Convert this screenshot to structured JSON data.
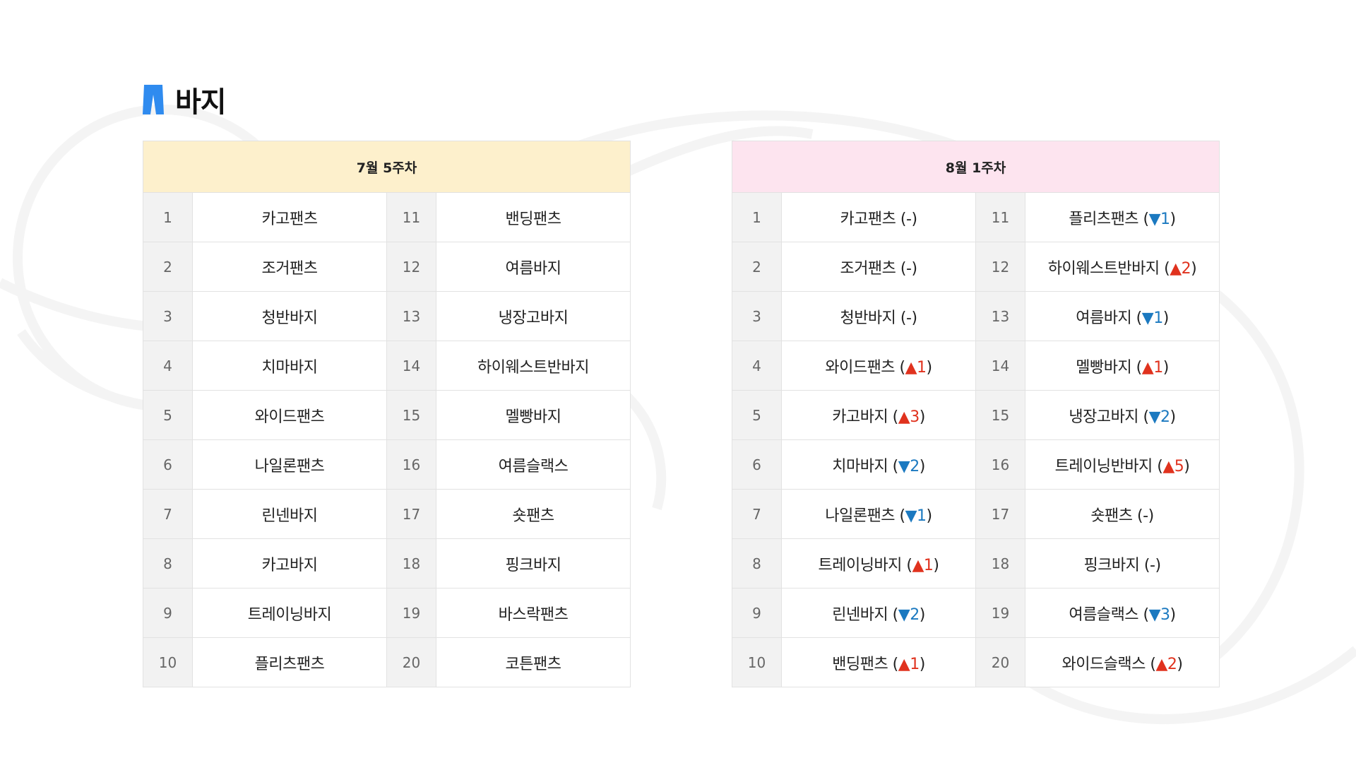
{
  "category": {
    "title": "바지",
    "icon": "pants-icon",
    "icon_color": "#2f8bef"
  },
  "colors": {
    "left_header_bg": "#fdf0cc",
    "right_header_bg": "#fde4ef",
    "up_color": "#e0321e",
    "down_color": "#1b79c0"
  },
  "left_table": {
    "header": "7월 5주차",
    "rows": [
      {
        "rank_a": "1",
        "name_a": "카고팬츠",
        "rank_b": "11",
        "name_b": "밴딩팬츠"
      },
      {
        "rank_a": "2",
        "name_a": "조거팬츠",
        "rank_b": "12",
        "name_b": "여름바지"
      },
      {
        "rank_a": "3",
        "name_a": "청반바지",
        "rank_b": "13",
        "name_b": "냉장고바지"
      },
      {
        "rank_a": "4",
        "name_a": "치마바지",
        "rank_b": "14",
        "name_b": "하이웨스트반바지"
      },
      {
        "rank_a": "5",
        "name_a": "와이드팬츠",
        "rank_b": "15",
        "name_b": "멜빵바지"
      },
      {
        "rank_a": "6",
        "name_a": "나일론팬츠",
        "rank_b": "16",
        "name_b": "여름슬랙스"
      },
      {
        "rank_a": "7",
        "name_a": "린넨바지",
        "rank_b": "17",
        "name_b": "숏팬츠"
      },
      {
        "rank_a": "8",
        "name_a": "카고바지",
        "rank_b": "18",
        "name_b": "핑크바지"
      },
      {
        "rank_a": "9",
        "name_a": "트레이닝바지",
        "rank_b": "19",
        "name_b": "바스락팬츠"
      },
      {
        "rank_a": "10",
        "name_a": "플리츠팬츠",
        "rank_b": "20",
        "name_b": "코튼팬츠"
      }
    ]
  },
  "right_table": {
    "header": "8월 1주차",
    "rows": [
      {
        "rank_a": "1",
        "name_a": "카고팬츠",
        "change_a": {
          "dir": "same",
          "value": "-"
        },
        "rank_b": "11",
        "name_b": "플리츠팬츠",
        "change_b": {
          "dir": "down",
          "value": "1"
        }
      },
      {
        "rank_a": "2",
        "name_a": "조거팬츠",
        "change_a": {
          "dir": "same",
          "value": "-"
        },
        "rank_b": "12",
        "name_b": "하이웨스트반바지",
        "change_b": {
          "dir": "up",
          "value": "2"
        }
      },
      {
        "rank_a": "3",
        "name_a": "청반바지",
        "change_a": {
          "dir": "same",
          "value": "-"
        },
        "rank_b": "13",
        "name_b": "여름바지",
        "change_b": {
          "dir": "down",
          "value": "1"
        }
      },
      {
        "rank_a": "4",
        "name_a": "와이드팬츠",
        "change_a": {
          "dir": "up",
          "value": "1"
        },
        "rank_b": "14",
        "name_b": "멜빵바지",
        "change_b": {
          "dir": "up",
          "value": "1"
        }
      },
      {
        "rank_a": "5",
        "name_a": "카고바지",
        "change_a": {
          "dir": "up",
          "value": "3"
        },
        "rank_b": "15",
        "name_b": "냉장고바지",
        "change_b": {
          "dir": "down",
          "value": "2"
        }
      },
      {
        "rank_a": "6",
        "name_a": "치마바지",
        "change_a": {
          "dir": "down",
          "value": "2"
        },
        "rank_b": "16",
        "name_b": "트레이닝반바지",
        "change_b": {
          "dir": "up",
          "value": "5"
        }
      },
      {
        "rank_a": "7",
        "name_a": "나일론팬츠",
        "change_a": {
          "dir": "down",
          "value": "1"
        },
        "rank_b": "17",
        "name_b": "숏팬츠",
        "change_b": {
          "dir": "same",
          "value": "-"
        }
      },
      {
        "rank_a": "8",
        "name_a": "트레이닝바지",
        "change_a": {
          "dir": "up",
          "value": "1"
        },
        "rank_b": "18",
        "name_b": "핑크바지",
        "change_b": {
          "dir": "same",
          "value": "-"
        }
      },
      {
        "rank_a": "9",
        "name_a": "린넨바지",
        "change_a": {
          "dir": "down",
          "value": "2"
        },
        "rank_b": "19",
        "name_b": "여름슬랙스",
        "change_b": {
          "dir": "down",
          "value": "3"
        }
      },
      {
        "rank_a": "10",
        "name_a": "밴딩팬츠",
        "change_a": {
          "dir": "up",
          "value": "1"
        },
        "rank_b": "20",
        "name_b": "와이드슬랙스",
        "change_b": {
          "dir": "up",
          "value": "2"
        }
      }
    ]
  }
}
